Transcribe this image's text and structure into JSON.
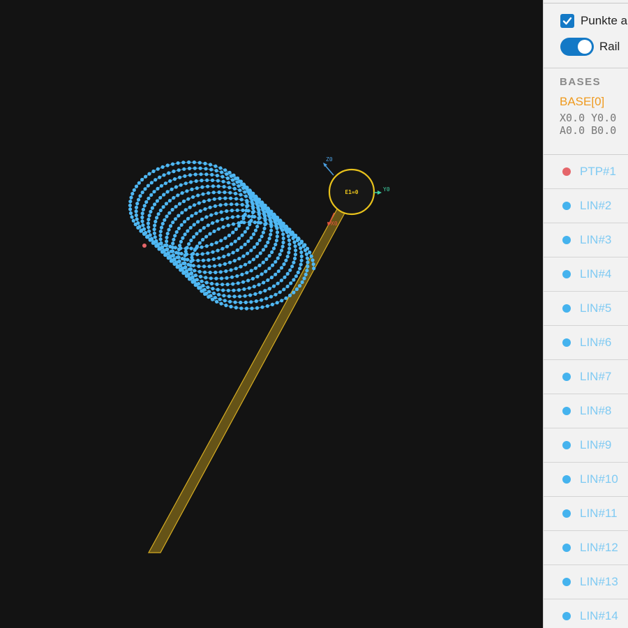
{
  "options": {
    "points_checkbox_label": "Punkte a",
    "points_checked": true,
    "rail_toggle_label": "Rail",
    "rail_on": true
  },
  "bases": {
    "title": "BASES",
    "items": [
      {
        "name": "BASE[0]",
        "line1": "X0.0 Y0.0",
        "line2": "A0.0 B0.0"
      }
    ]
  },
  "points": [
    {
      "label": "PTP#1",
      "color": "#e5666a"
    },
    {
      "label": "LIN#2",
      "color": "#45b3ee"
    },
    {
      "label": "LIN#3",
      "color": "#45b3ee"
    },
    {
      "label": "LIN#4",
      "color": "#45b3ee"
    },
    {
      "label": "LIN#5",
      "color": "#45b3ee"
    },
    {
      "label": "LIN#6",
      "color": "#45b3ee"
    },
    {
      "label": "LIN#7",
      "color": "#45b3ee"
    },
    {
      "label": "LIN#8",
      "color": "#45b3ee"
    },
    {
      "label": "LIN#9",
      "color": "#45b3ee"
    },
    {
      "label": "LIN#10",
      "color": "#45b3ee"
    },
    {
      "label": "LIN#11",
      "color": "#45b3ee"
    },
    {
      "label": "LIN#12",
      "color": "#45b3ee"
    },
    {
      "label": "LIN#13",
      "color": "#45b3ee"
    },
    {
      "label": "LIN#14",
      "color": "#45b3ee"
    }
  ],
  "scene": {
    "rail_label": "E1=0",
    "axes": {
      "x": "X0",
      "y": "Y0",
      "z": "Z0"
    },
    "colors": {
      "background": "#131313",
      "rail": "#c9a21c",
      "ring": "#e8c21c",
      "path": "#4fb8f4",
      "start_point": "#e5666a",
      "axis_x": "#e0553a",
      "axis_y": "#3fd1a3",
      "axis_z": "#4b9fe0"
    },
    "icons": {
      "checkbox": "check-icon",
      "toggle": "toggle-switch-icon"
    }
  }
}
